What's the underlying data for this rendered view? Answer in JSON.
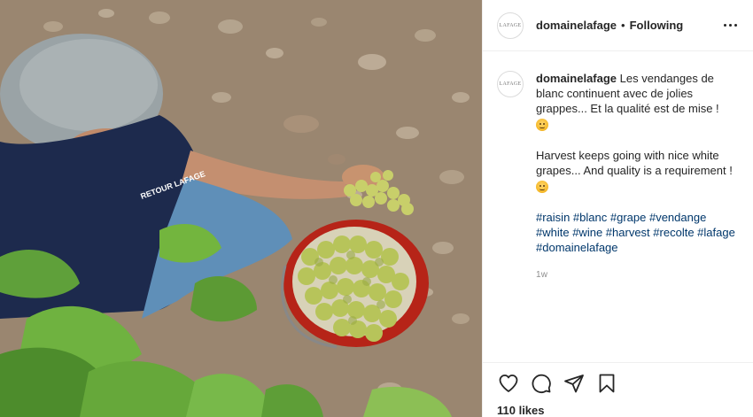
{
  "post": {
    "username": "domainelafage",
    "separator": "•",
    "follow_status": "Following",
    "avatar_text": "LAFAGE",
    "caption": {
      "username": "domainelafage",
      "text_fr": "Les vendanges de blanc continuent avec de jolies grappes... Et la qualité est de mise !",
      "text_en": "Harvest keeps going with nice white grapes... And quality is a requirement !",
      "hashtags": [
        "#raisin",
        "#blanc",
        "#grape",
        "#vendange",
        "#white",
        "#wine",
        "#harvest",
        "#recolte",
        "#lafage",
        "#domainelafage"
      ]
    },
    "time_ago": "1w",
    "likes": "110 likes"
  },
  "photo": {
    "shirt_text": "RETOUR LAFAGE"
  },
  "icons": {
    "more": "more-options-icon",
    "like": "heart-icon",
    "comment": "comment-icon",
    "share": "share-icon",
    "save": "bookmark-icon",
    "emoji": "grinning-face-icon"
  },
  "colors": {
    "link": "#00376b",
    "text": "#262626",
    "muted": "#8e8e8e",
    "bucket": "#c8281e"
  }
}
